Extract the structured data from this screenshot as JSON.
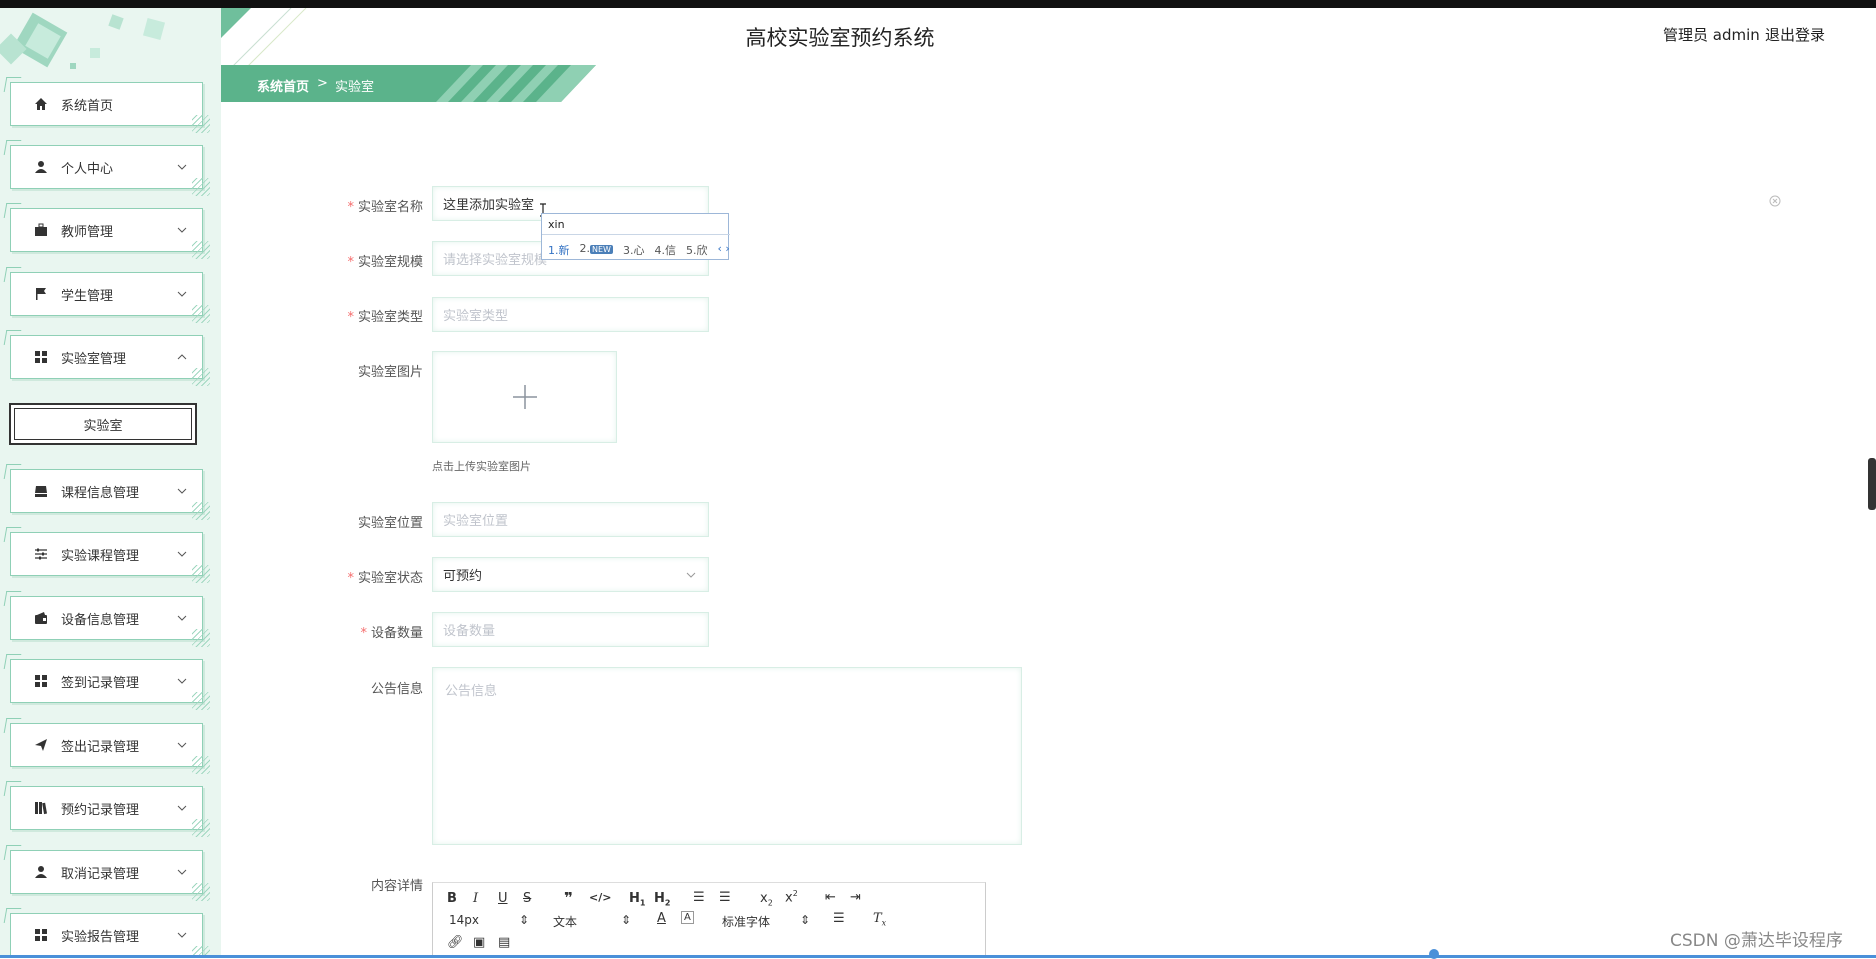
{
  "app": {
    "title": "高校实验室预约系统",
    "user": "管理员 admin",
    "logout": "退出登录"
  },
  "breadcrumb": {
    "home": "系统首页",
    "sep": ">",
    "current": "实验室"
  },
  "sidebar": {
    "items": [
      {
        "label": "系统首页",
        "icon": "home-icon"
      },
      {
        "label": "个人中心",
        "icon": "person-icon"
      },
      {
        "label": "教师管理",
        "icon": "briefcase-icon"
      },
      {
        "label": "学生管理",
        "icon": "flag-icon"
      },
      {
        "label": "实验室管理",
        "icon": "grid-icon"
      },
      {
        "label": "课程信息管理",
        "icon": "inbox-icon"
      },
      {
        "label": "实验课程管理",
        "icon": "sliders-icon"
      },
      {
        "label": "设备信息管理",
        "icon": "wallet-icon"
      },
      {
        "label": "签到记录管理",
        "icon": "grid-icon"
      },
      {
        "label": "签出记录管理",
        "icon": "send-icon"
      },
      {
        "label": "预约记录管理",
        "icon": "books-icon"
      },
      {
        "label": "取消记录管理",
        "icon": "person-icon"
      },
      {
        "label": "实验报告管理",
        "icon": "grid-icon"
      }
    ],
    "submenu": {
      "label": "实验室"
    }
  },
  "form": {
    "name": {
      "label": "实验室名称",
      "value": "这里添加实验室"
    },
    "scale": {
      "label": "实验室规模",
      "placeholder": "请选择实验室规模"
    },
    "type": {
      "label": "实验室类型",
      "placeholder": "实验室类型"
    },
    "image": {
      "label": "实验室图片",
      "tip": "点击上传实验室图片"
    },
    "location": {
      "label": "实验室位置",
      "placeholder": "实验室位置"
    },
    "status": {
      "label": "实验室状态",
      "value": "可预约"
    },
    "equipment": {
      "label": "设备数量",
      "placeholder": "设备数量"
    },
    "notice": {
      "label": "公告信息",
      "placeholder": "公告信息"
    },
    "content": {
      "label": "内容详情"
    }
  },
  "ime": {
    "pinyin": "xin",
    "candidates": [
      "1.新",
      "2.",
      "3.心",
      "4.信",
      "5.欣"
    ],
    "new_badge": "NEW"
  },
  "editor": {
    "font_size": "14px",
    "block": "文本",
    "font": "标准字体"
  },
  "watermark": "CSDN @萧达毕设程序"
}
